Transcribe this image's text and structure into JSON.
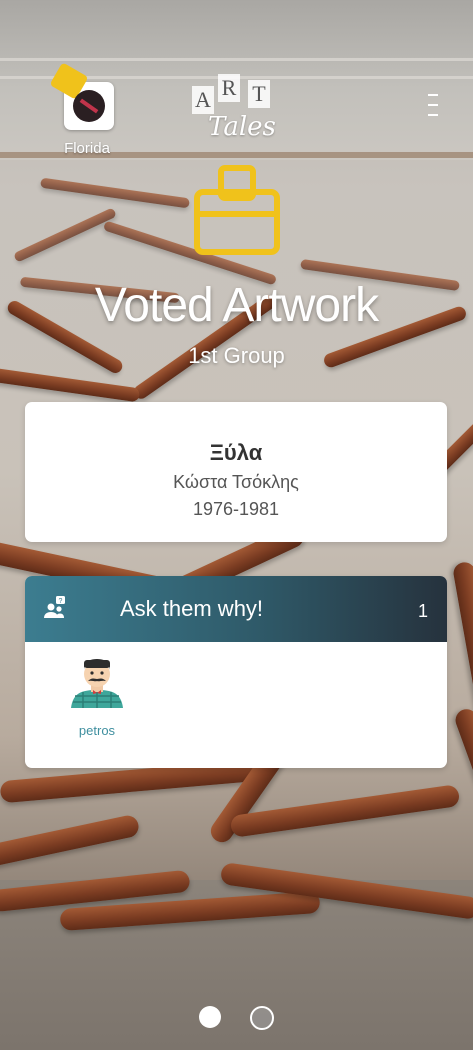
{
  "header": {
    "group_label": "Florida",
    "brand_tiles": [
      "A",
      "R",
      "T"
    ],
    "brand_sub": "Tales",
    "menu_icon": "vertical-dots-icon"
  },
  "main": {
    "icon": "ballot-box-icon",
    "title": "Voted Artwork",
    "subtitle": "1st Group"
  },
  "artwork": {
    "name": "Ξύλα",
    "artist": "Κώστα Τσόκλης",
    "years": "1976-1981"
  },
  "ask": {
    "icon": "group-question-icon",
    "title": "Ask them why!",
    "count": "1",
    "users": [
      {
        "name": "petros",
        "avatar": "man-with-mustache-avatar"
      }
    ]
  },
  "pager": {
    "pages": 2,
    "active": 1
  },
  "colors": {
    "accent_yellow": "#f0c21b",
    "ask_header_start": "#3c7d90",
    "ask_header_end": "#26323d",
    "username": "#3f8f9f"
  }
}
